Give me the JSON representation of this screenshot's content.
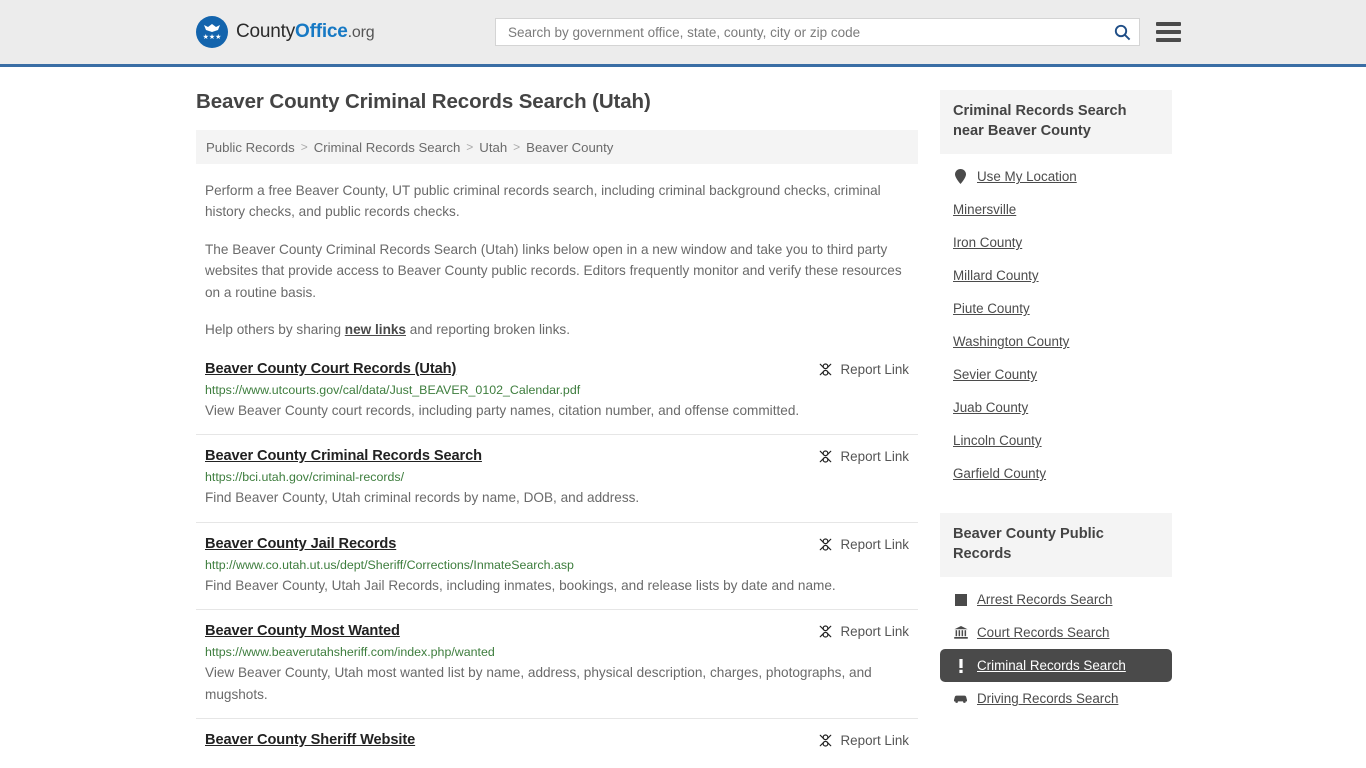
{
  "header": {
    "logo": {
      "icon": "eagle-seal-icon",
      "part1": "County",
      "part2": "Office",
      "part3": ".org"
    },
    "search": {
      "placeholder": "Search by government office, state, county, city or zip code",
      "value": "",
      "search_icon": "search-icon"
    },
    "menu_icon": "hamburger-menu-icon",
    "accent_color": "#3a6ea5"
  },
  "main": {
    "page_title": "Beaver County Criminal Records Search (Utah)",
    "breadcrumb": [
      "Public Records",
      "Criminal Records Search",
      "Utah",
      "Beaver County"
    ],
    "breadcrumb_separator": ">",
    "intro": {
      "p1": "Perform a free Beaver County, UT public criminal records search, including criminal background checks, criminal history checks, and public records checks.",
      "p2": "The Beaver County Criminal Records Search (Utah) links below open in a new window and take you to third party websites that provide access to Beaver County public records. Editors frequently monitor and verify these resources on a routine basis.",
      "p3_before": "Help others by sharing ",
      "p3_link": "new links",
      "p3_after": " and reporting broken links."
    },
    "report_link_label": "Report Link",
    "report_link_icon": "broken-link-icon",
    "links": [
      {
        "title": "Beaver County Court Records (Utah)",
        "url": "https://www.utcourts.gov/cal/data/Just_BEAVER_0102_Calendar.pdf",
        "description": "View Beaver County court records, including party names, citation number, and offense committed."
      },
      {
        "title": "Beaver County Criminal Records Search",
        "url": "https://bci.utah.gov/criminal-records/",
        "description": "Find Beaver County, Utah criminal records by name, DOB, and address."
      },
      {
        "title": "Beaver County Jail Records",
        "url": "http://www.co.utah.ut.us/dept/Sheriff/Corrections/InmateSearch.asp",
        "description": "Find Beaver County, Utah Jail Records, including inmates, bookings, and release lists by date and name."
      },
      {
        "title": "Beaver County Most Wanted",
        "url": "https://www.beaverutahsheriff.com/index.php/wanted",
        "description": "View Beaver County, Utah most wanted list by name, address, physical description, charges, photographs, and mugshots."
      },
      {
        "title": "Beaver County Sheriff Website",
        "url": "",
        "description": ""
      }
    ]
  },
  "sidebar": {
    "near_card": {
      "title": "Criminal Records Search near Beaver County",
      "items": [
        {
          "label": "Use My Location",
          "icon": "map-pin-icon"
        },
        {
          "label": "Minersville",
          "icon": ""
        },
        {
          "label": "Iron County",
          "icon": ""
        },
        {
          "label": "Millard County",
          "icon": ""
        },
        {
          "label": "Piute County",
          "icon": ""
        },
        {
          "label": "Washington County",
          "icon": ""
        },
        {
          "label": "Sevier County",
          "icon": ""
        },
        {
          "label": "Juab County",
          "icon": ""
        },
        {
          "label": "Lincoln County",
          "icon": ""
        },
        {
          "label": "Garfield County",
          "icon": ""
        }
      ]
    },
    "public_records_card": {
      "title": "Beaver County Public Records",
      "active_color": "#4a4a4a",
      "items": [
        {
          "label": "Arrest Records Search",
          "icon": "square-icon",
          "active": false
        },
        {
          "label": "Court Records Search",
          "icon": "courthouse-icon",
          "active": false
        },
        {
          "label": "Criminal Records Search",
          "icon": "exclamation-icon",
          "active": true
        },
        {
          "label": "Driving Records Search",
          "icon": "car-icon",
          "active": false
        }
      ]
    }
  }
}
